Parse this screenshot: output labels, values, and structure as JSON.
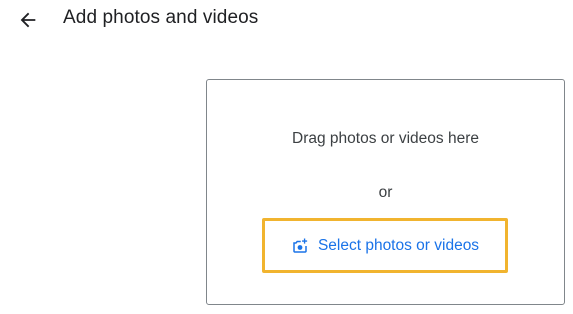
{
  "header": {
    "back_icon": "arrow-left-icon",
    "title": "Add photos and videos"
  },
  "dropzone": {
    "drag_text": "Drag photos or videos here",
    "or_text": "or",
    "select_button": {
      "icon": "add-photo-icon",
      "label": "Select photos or videos"
    }
  },
  "colors": {
    "title_text": "#202124",
    "body_text": "#3c4043",
    "accent_blue": "#1a73e8",
    "highlight_border": "#f1b42f",
    "dropzone_border": "#80868b"
  }
}
